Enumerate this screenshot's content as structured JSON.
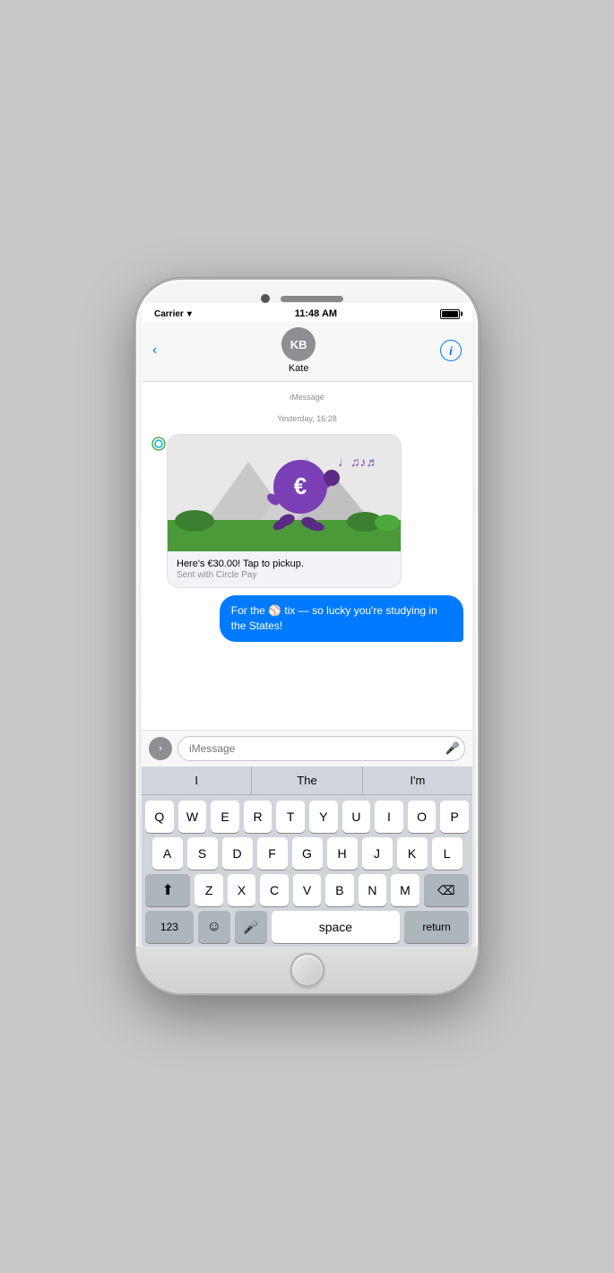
{
  "status": {
    "carrier": "Carrier",
    "time": "11:48 AM",
    "wifi": true,
    "battery_full": true
  },
  "nav": {
    "back_label": "‹",
    "avatar_initials": "KB",
    "contact_name": "Kate",
    "info_label": "i"
  },
  "messages": {
    "timestamp_service": "iMessage",
    "timestamp_date": "Yesterday, 16:28",
    "card": {
      "main_text": "Here's €30.00! Tap to pickup.",
      "sub_text": "Sent with Circle Pay"
    },
    "sent_text": "For the ⚾ tix — so lucky you're studying in the States!"
  },
  "input": {
    "placeholder": "iMessage"
  },
  "autocomplete": {
    "option1": "I",
    "option2": "The",
    "option3": "I'm"
  },
  "keyboard": {
    "row1": [
      "Q",
      "W",
      "E",
      "R",
      "T",
      "Y",
      "U",
      "I",
      "O",
      "P"
    ],
    "row2": [
      "A",
      "S",
      "D",
      "F",
      "G",
      "H",
      "J",
      "K",
      "L"
    ],
    "row3": [
      "Z",
      "X",
      "C",
      "V",
      "B",
      "N",
      "M"
    ],
    "shift_icon": "⬆",
    "delete_icon": "⌫",
    "num_label": "123",
    "emoji_icon": "☺",
    "mic_icon": "🎤",
    "space_label": "space",
    "return_label": "return"
  }
}
